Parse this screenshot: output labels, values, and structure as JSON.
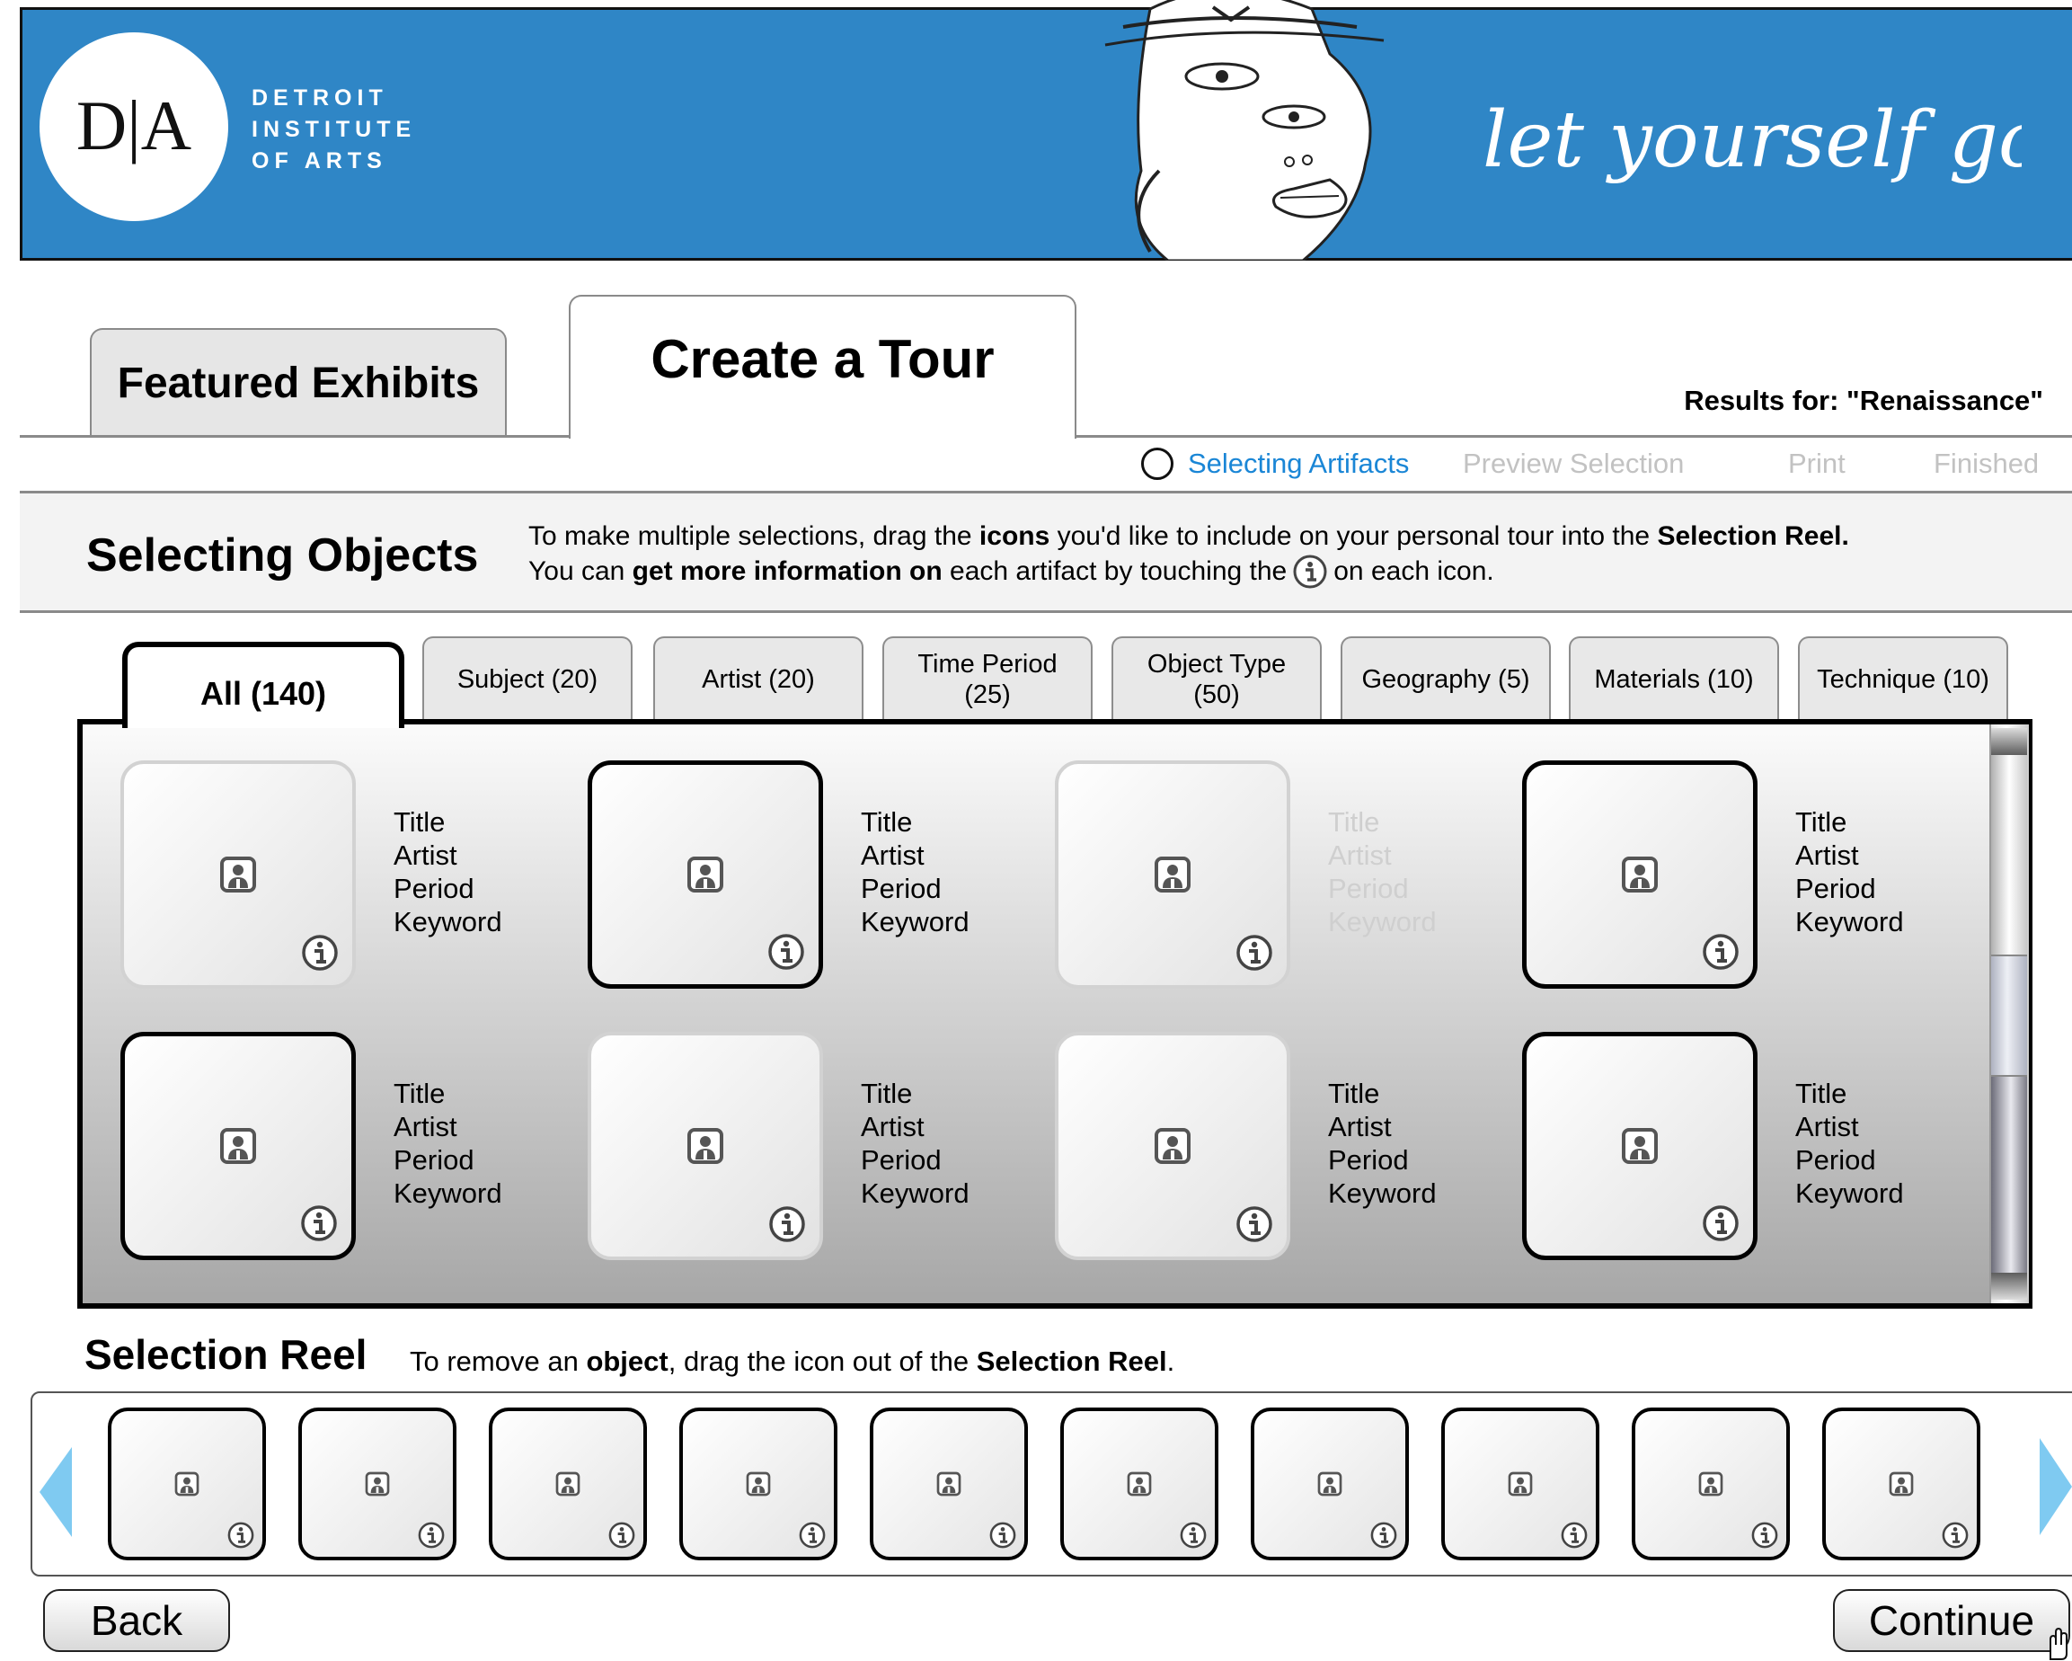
{
  "header": {
    "logo_letters": "D|A",
    "logo_lines": [
      "DETROIT",
      "INSTITUTE",
      "OF ARTS"
    ],
    "tagline": "let yourself go",
    "banner_color": "#2f86c6"
  },
  "tabs": {
    "featured": "Featured Exhibits",
    "create": "Create a Tour",
    "active": "create"
  },
  "results_label": "Results for: \"Renaissance\"",
  "steps": {
    "current": "Selecting Artifacts",
    "preview": "Preview Selection",
    "print": "Print",
    "finished": "Finished",
    "current_color": "#1a86d6",
    "inactive_color": "#c2c2c2"
  },
  "instructions": {
    "title": "Selecting Objects",
    "line1": [
      {
        "text": "To make multiple selections, drag the ",
        "bold": false
      },
      {
        "text": "icons",
        "bold": true
      },
      {
        "text": " you'd like to include on your personal tour into the ",
        "bold": false
      },
      {
        "text": "Selection Reel.",
        "bold": true
      }
    ],
    "line2_before": [
      {
        "text": "You can ",
        "bold": false
      },
      {
        "text": "get more information on",
        "bold": true
      },
      {
        "text": " each artifact by touching the",
        "bold": false
      }
    ],
    "line2_after": "on each icon."
  },
  "filters": [
    {
      "label": "All  (140)",
      "active": true
    },
    {
      "label": "Subject (20)",
      "active": false
    },
    {
      "label": "Artist (20)",
      "active": false
    },
    {
      "label": "Time Period\n(25)",
      "active": false
    },
    {
      "label": "Object Type\n(50)",
      "active": false
    },
    {
      "label": "Geography (5)",
      "active": false
    },
    {
      "label": "Materials (10)",
      "active": false
    },
    {
      "label": "Technique (10)",
      "active": false
    }
  ],
  "artifacts": [
    {
      "title": "Title",
      "artist": "Artist",
      "period": "Period",
      "keyword": "Keyword",
      "selected": false,
      "dimmed": false
    },
    {
      "title": "Title",
      "artist": "Artist",
      "period": "Period",
      "keyword": "Keyword",
      "selected": true,
      "dimmed": false
    },
    {
      "title": "Title",
      "artist": "Artist",
      "period": "Period",
      "keyword": "Keyword",
      "selected": false,
      "dimmed": true
    },
    {
      "title": "Title",
      "artist": "Artist",
      "period": "Period",
      "keyword": "Keyword",
      "selected": true,
      "dimmed": false
    },
    {
      "title": "Title",
      "artist": "Artist",
      "period": "Period",
      "keyword": "Keyword",
      "selected": true,
      "dimmed": false
    },
    {
      "title": "Title",
      "artist": "Artist",
      "period": "Period",
      "keyword": "Keyword",
      "selected": false,
      "dimmed": false
    },
    {
      "title": "Title",
      "artist": "Artist",
      "period": "Period",
      "keyword": "Keyword",
      "selected": false,
      "dimmed": false
    },
    {
      "title": "Title",
      "artist": "Artist",
      "period": "Period",
      "keyword": "Keyword",
      "selected": true,
      "dimmed": false
    }
  ],
  "reel": {
    "title": "Selection Reel",
    "hint": [
      {
        "text": "To remove an ",
        "bold": false
      },
      {
        "text": "object",
        "bold": true
      },
      {
        "text": ", drag the icon out of the ",
        "bold": false
      },
      {
        "text": "Selection Reel",
        "bold": true
      },
      {
        "text": ".",
        "bold": false
      }
    ],
    "item_count": 10,
    "arrow_color": "#7fcaf1"
  },
  "buttons": {
    "back": "Back",
    "continue": "Continue"
  },
  "icons": {
    "artifact": "person-placeholder-icon",
    "info": "info-icon",
    "cursor": "hand-cursor-icon"
  }
}
